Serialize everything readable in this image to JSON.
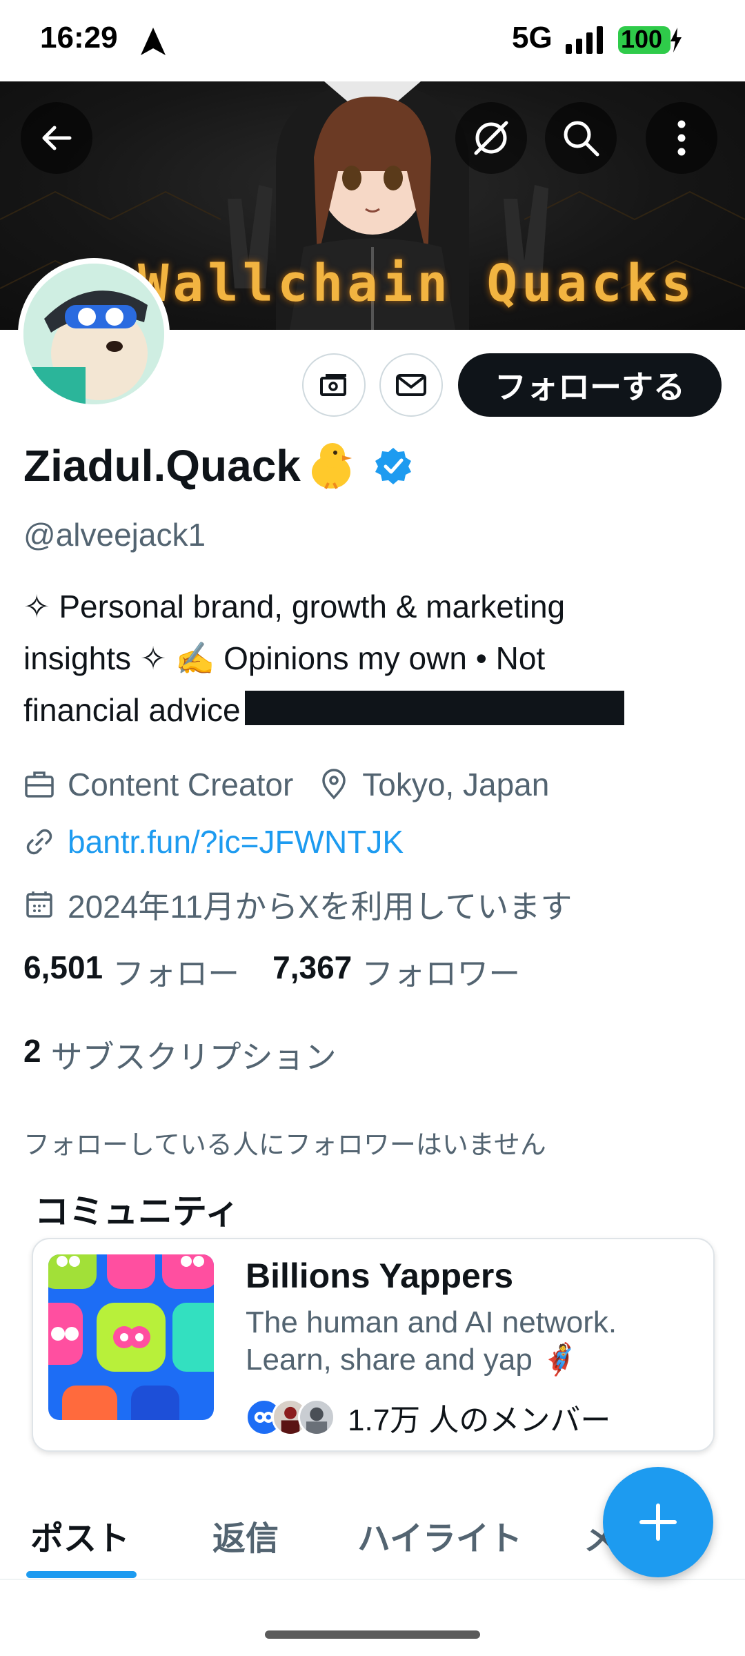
{
  "status_bar": {
    "time": "16:29",
    "network": "5G",
    "battery": "100"
  },
  "header": {
    "banner_text": "Wallchain Quacks"
  },
  "profile": {
    "follow_label": "フォローする",
    "name": "Ziadul.Quack",
    "handle": "@alveejack1",
    "bio_line1": "✧ Personal brand, growth & marketing",
    "bio_line2": "insights ✧ ✍️ Opinions my own • Not",
    "bio_line3": "financial advice",
    "category": "Content Creator",
    "location": "Tokyo, Japan",
    "website": "bantr.fun/?ic=JFWNTJK",
    "joined": "2024年11月からXを利用しています",
    "following_count": "6,501",
    "following_label": "フォロー",
    "followers_count": "7,367",
    "followers_label": "フォロワー",
    "subscriptions_count": "2",
    "subscriptions_label": "サブスクリプション",
    "followers_you_know": "フォローしている人にフォロワーはいません"
  },
  "community": {
    "section_title": "コミュニティ",
    "name": "Billions Yappers",
    "desc_line1": "The human and AI network.",
    "desc_line2": "Learn, share and yap 🦸",
    "members": "1.7万 人のメンバー"
  },
  "tabs": [
    "ポスト",
    "返信",
    "ハイライト",
    "メ"
  ],
  "colors": {
    "accent": "#1d9bf0",
    "text": "#0f1419",
    "muted": "#536471",
    "battery": "#2fcb4a"
  }
}
